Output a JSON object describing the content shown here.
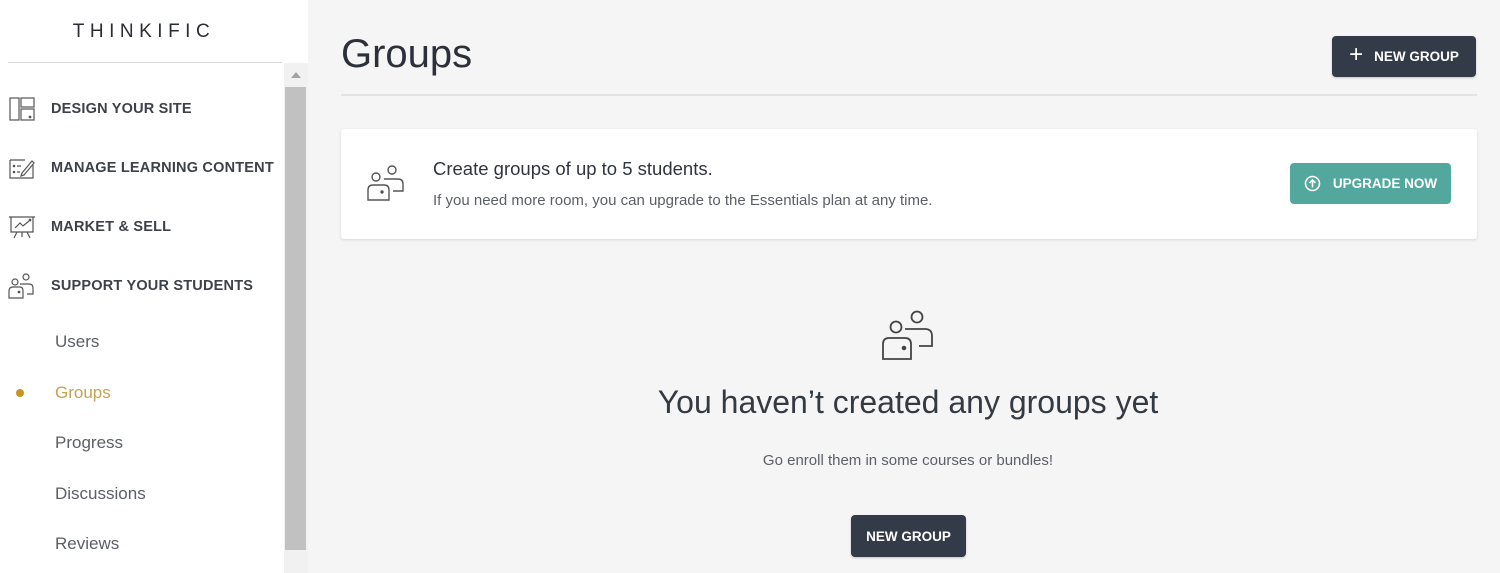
{
  "brand": {
    "logo_text": "THINKIFIC"
  },
  "sidebar": {
    "sections": [
      {
        "label": "DESIGN YOUR SITE",
        "icon": "layout-icon"
      },
      {
        "label": "MANAGE LEARNING CONTENT",
        "icon": "edit-board-icon"
      },
      {
        "label": "MARKET & SELL",
        "icon": "presentation-chart-icon"
      },
      {
        "label": "SUPPORT YOUR STUDENTS",
        "icon": "users-icon"
      }
    ],
    "sub_items": [
      {
        "label": "Users",
        "active": false
      },
      {
        "label": "Groups",
        "active": true
      },
      {
        "label": "Progress",
        "active": false
      },
      {
        "label": "Discussions",
        "active": false
      },
      {
        "label": "Reviews",
        "active": false
      }
    ]
  },
  "header": {
    "title": "Groups",
    "new_group_label": "NEW GROUP",
    "new_group_icon": "plus-icon"
  },
  "info_card": {
    "icon": "users-icon",
    "title": "Create groups of up to 5 students.",
    "subtitle": "If you need more room, you can upgrade to the Essentials plan at any time.",
    "upgrade_label": "UPGRADE NOW",
    "upgrade_icon": "arrow-up-circle-icon"
  },
  "empty_state": {
    "icon": "users-icon",
    "title": "You haven’t created any groups yet",
    "subtitle": "Go enroll them in some courses or bundles!",
    "button_label": "NEW GROUP"
  },
  "colors": {
    "accent_gold": "#c8951e",
    "active_text": "#c7a251",
    "dark_button": "#343b48",
    "upgrade_teal": "#53a89d",
    "page_bg": "#f5f5f5"
  }
}
